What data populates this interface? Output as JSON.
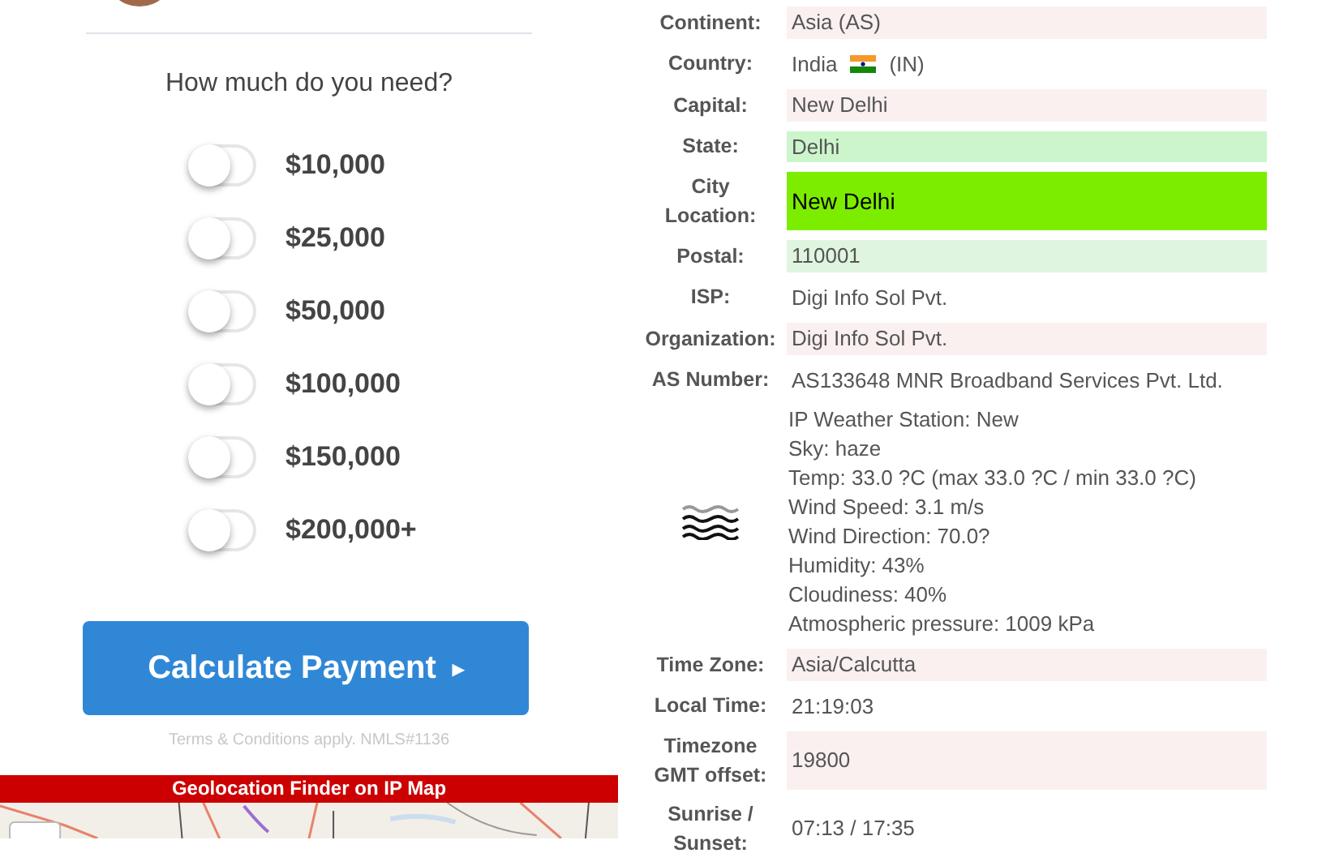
{
  "loan_form": {
    "question": "How much do you need?",
    "amounts": [
      {
        "label": "$10,000",
        "on": false
      },
      {
        "label": "$25,000",
        "on": false
      },
      {
        "label": "$50,000",
        "on": false
      },
      {
        "label": "$100,000",
        "on": false
      },
      {
        "label": "$150,000",
        "on": false
      },
      {
        "label": "$200,000+",
        "on": false
      }
    ],
    "submit": "Calculate Payment",
    "caret": "▸",
    "terms": "Terms & Conditions apply. NMLS#1136"
  },
  "map_banner": {
    "title": "Geolocation Finder on IP Map"
  },
  "details": [
    {
      "kind": "text",
      "label": "Continent:",
      "value": "Asia (AS)",
      "color": "#fbf0f0",
      "emphasis": false
    },
    {
      "kind": "flag",
      "label": "Country:",
      "value": "India",
      "suffix": "(IN)",
      "emphasis": false
    },
    {
      "kind": "text",
      "label": "Capital:",
      "value": "New Delhi",
      "color": "#fbf0f0",
      "emphasis": false
    },
    {
      "kind": "text",
      "label": "State:",
      "value": "Delhi",
      "color": "#ccf5cc",
      "emphasis": false
    },
    {
      "kind": "text",
      "label": "City Location:",
      "value": "New Delhi",
      "color": "#7ded00",
      "emphasis": true
    },
    {
      "kind": "text",
      "label": "Postal:",
      "value": "110001",
      "color": "#e0f5e0",
      "emphasis": false
    },
    {
      "kind": "text",
      "label": "ISP:",
      "value": "Digi Info Sol Pvt.",
      "emphasis": false
    },
    {
      "kind": "text",
      "label": "Organization:",
      "value": "Digi Info Sol Pvt.",
      "color": "#fbf0f0",
      "emphasis": false
    },
    {
      "kind": "text",
      "label": "AS Number:",
      "value": "AS133648 MNR Broadband Services Pvt. Ltd.",
      "emphasis": false
    },
    {
      "kind": "weather",
      "lines": [
        "IP Weather Station: New",
        "Sky: haze",
        "Temp: 33.0 ?C (max 33.0 ?C / min 33.0 ?C)",
        "Wind Speed: 3.1 m/s",
        "Wind Direction: 70.0?",
        "Humidity: 43%",
        "Cloudiness: 40%",
        "Atmospheric pressure: 1009 kPa"
      ]
    },
    {
      "kind": "text",
      "label": "Time Zone:",
      "value": "Asia/Calcutta",
      "color": "#fbf0f0",
      "emphasis": false
    },
    {
      "kind": "text",
      "label": "Local Time:",
      "value": "21:19:03",
      "emphasis": false
    },
    {
      "kind": "text",
      "label": "Timezone GMT offset:",
      "value": "19800",
      "color": "#fbf0f0",
      "emphasis": false
    },
    {
      "kind": "text",
      "label": "Sunrise / Sunset:",
      "value": "07:13 / 17:35",
      "emphasis": false
    }
  ]
}
